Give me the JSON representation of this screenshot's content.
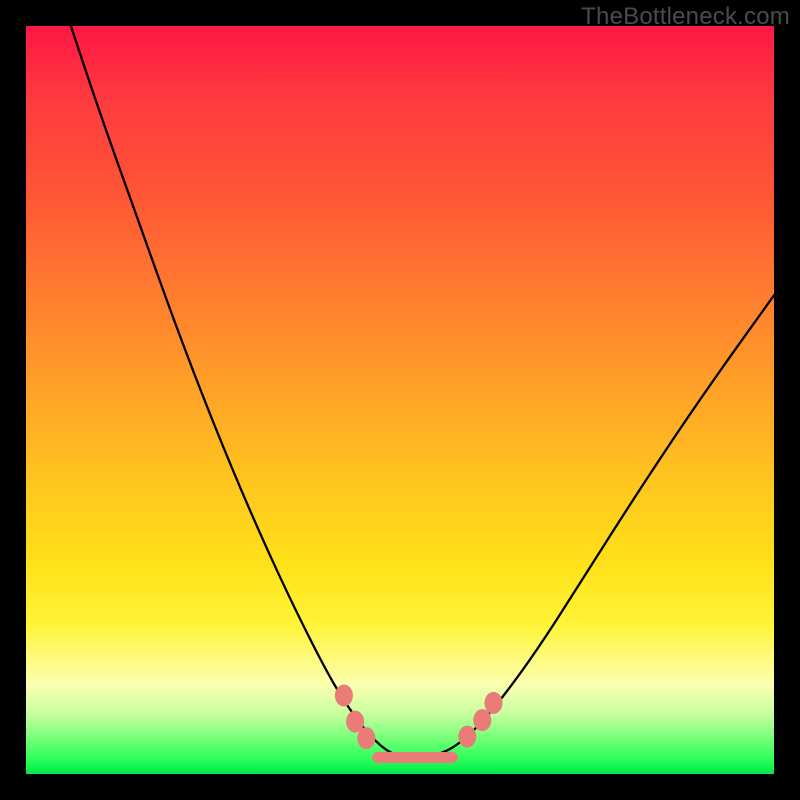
{
  "watermark": "TheBottleneck.com",
  "colors": {
    "frame": "#000000",
    "curve": "#000000",
    "bead": "#e97c77",
    "gradient_top": "#ff1744",
    "gradient_mid": "#ffe119",
    "gradient_bottom": "#00e84a"
  },
  "chart_data": {
    "type": "line",
    "title": "",
    "xlabel": "",
    "ylabel": "",
    "xlim": [
      0,
      100
    ],
    "ylim": [
      0,
      100
    ],
    "grid": false,
    "legend": false,
    "series": [
      {
        "name": "bottleneck-curve",
        "x": [
          6,
          10,
          15,
          20,
          25,
          30,
          35,
          40,
          43,
          46,
          49,
          52,
          55,
          58,
          62,
          68,
          75,
          82,
          90,
          100
        ],
        "y": [
          100,
          88,
          74,
          60,
          47,
          35,
          24,
          14,
          9,
          5,
          2.5,
          2,
          2.5,
          4,
          8,
          16,
          27,
          38,
          50,
          64
        ]
      }
    ],
    "markers": [
      {
        "name": "left-bead-upper",
        "x": 42.5,
        "y": 10.5
      },
      {
        "name": "left-bead-mid",
        "x": 44.0,
        "y": 7.0
      },
      {
        "name": "left-bead-lower",
        "x": 45.5,
        "y": 4.8
      },
      {
        "name": "right-bead-lower",
        "x": 59.0,
        "y": 5.0
      },
      {
        "name": "right-bead-mid",
        "x": 61.0,
        "y": 7.2
      },
      {
        "name": "right-bead-upper",
        "x": 62.5,
        "y": 9.5
      }
    ],
    "bottom_chain": {
      "x_start": 47,
      "x_end": 57,
      "y": 2.2
    }
  }
}
